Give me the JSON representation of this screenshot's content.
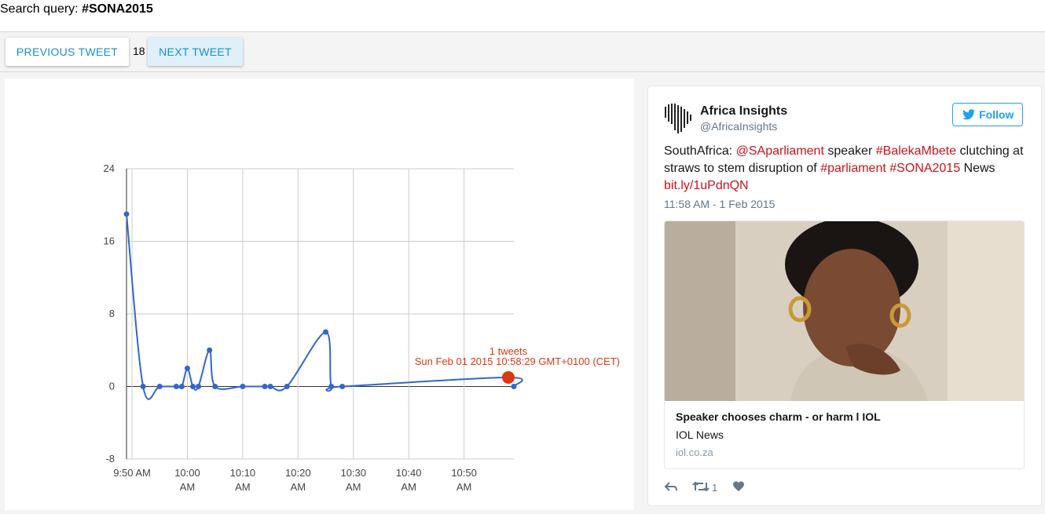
{
  "header": {
    "query_label": "Search query:",
    "query_value": "#SONA2015"
  },
  "nav": {
    "prev_label": "PREVIOUS TWEET",
    "counter": "18",
    "next_label": "NEXT TWEET"
  },
  "chart_data": {
    "type": "line",
    "title": "",
    "xlabel": "",
    "ylabel": "",
    "ylim": [
      -8,
      24
    ],
    "yticks": [
      -8,
      0,
      8,
      16,
      24
    ],
    "xlim": [
      "9:49",
      "10:59"
    ],
    "xticks": [
      {
        "t": "9:50",
        "label1": "9:50 AM",
        "label2": ""
      },
      {
        "t": "10:00",
        "label1": "10:00",
        "label2": "AM"
      },
      {
        "t": "10:10",
        "label1": "10:10",
        "label2": "AM"
      },
      {
        "t": "10:20",
        "label1": "10:20",
        "label2": "AM"
      },
      {
        "t": "10:30",
        "label1": "10:30",
        "label2": "AM"
      },
      {
        "t": "10:40",
        "label1": "10:40",
        "label2": "AM"
      },
      {
        "t": "10:50",
        "label1": "10:50",
        "label2": "AM"
      }
    ],
    "grid": true,
    "series": [
      {
        "color": "#3366cc",
        "x": [
          "9:49",
          "9:52",
          "9:55",
          "9:58",
          "9:59",
          "10:00",
          "10:01",
          "10:02",
          "10:04",
          "10:05",
          "10:10",
          "10:14",
          "10:15",
          "10:18",
          "10:25",
          "10:26",
          "10:28",
          "10:58",
          "10:59"
        ],
        "y": [
          19,
          0,
          0,
          0,
          0,
          2,
          0,
          0,
          4,
          0,
          0,
          0,
          0,
          0,
          6,
          0,
          0,
          1,
          0
        ]
      }
    ],
    "highlight": {
      "x": "10:58",
      "y": 1,
      "color": "#dc3912",
      "label_line1": "1 tweets",
      "label_line2": "Sun Feb 01 2015 10:58:29 GMT+0100 (CET)"
    }
  },
  "tweet": {
    "author_name": "Africa Insights",
    "author_handle": "@AfricaInsights",
    "follow_label": "Follow",
    "text_prefix": "SouthAfrica: ",
    "mention": "@SAparliament",
    "text_mid1": " speaker ",
    "hashtag1": "#BalekaMbete",
    "text_mid2": " clutching at straws to stem disruption of ",
    "hashtag2": "#parliament",
    "text_mid3": " ",
    "hashtag3": "#SONA2015",
    "text_mid4": " News ",
    "link": "bit.ly/1uPdnQN",
    "timestamp": "11:58 AM - 1 Feb 2015",
    "card_title": "Speaker chooses charm - or harm l IOL",
    "card_source": "IOL News",
    "card_domain": "iol.co.za",
    "retweet_count": "1",
    "link_color": "#c8141b",
    "follow_color": "#1da1f2"
  }
}
